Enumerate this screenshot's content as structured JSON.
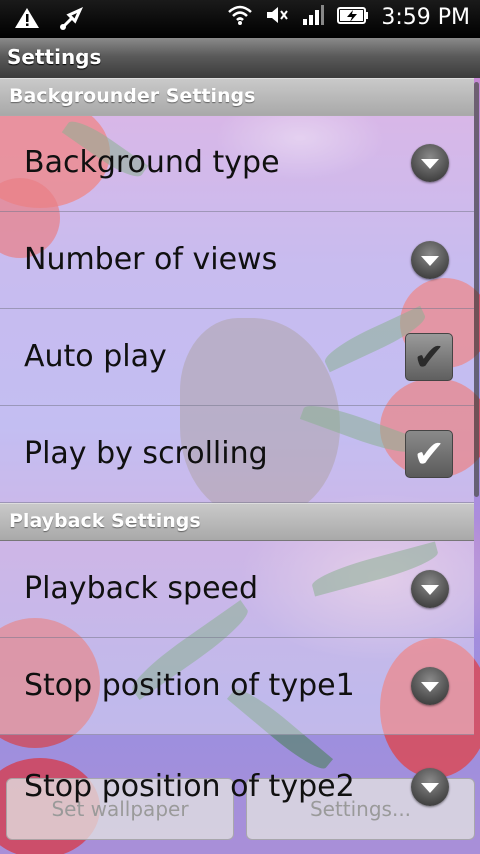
{
  "status_bar": {
    "icons_left": [
      "warning-icon",
      "usb-debug-icon"
    ],
    "icons_right": [
      "wifi-icon",
      "mute-icon",
      "signal-icon",
      "battery-charging-icon"
    ],
    "time": "3:59 PM"
  },
  "title": "Settings",
  "sections": [
    {
      "header": "Backgrounder Settings",
      "items": [
        {
          "label": "Background type",
          "control": "dropdown"
        },
        {
          "label": "Number of views",
          "control": "dropdown"
        },
        {
          "label": "Auto play",
          "control": "checkbox",
          "checked": true
        },
        {
          "label": "Play by scrolling",
          "control": "checkbox",
          "checked": true
        }
      ]
    },
    {
      "header": "Playback Settings",
      "items": [
        {
          "label": "Playback speed",
          "control": "dropdown"
        },
        {
          "label": "Stop position of type1",
          "control": "dropdown"
        },
        {
          "label": "Stop position of type2",
          "control": "dropdown"
        }
      ]
    }
  ],
  "buttons": {
    "set_wallpaper": "Set wallpaper",
    "settings": "Settings..."
  },
  "colors": {
    "check_dark": "#2b2b2b",
    "check_light": "#ffffff"
  }
}
